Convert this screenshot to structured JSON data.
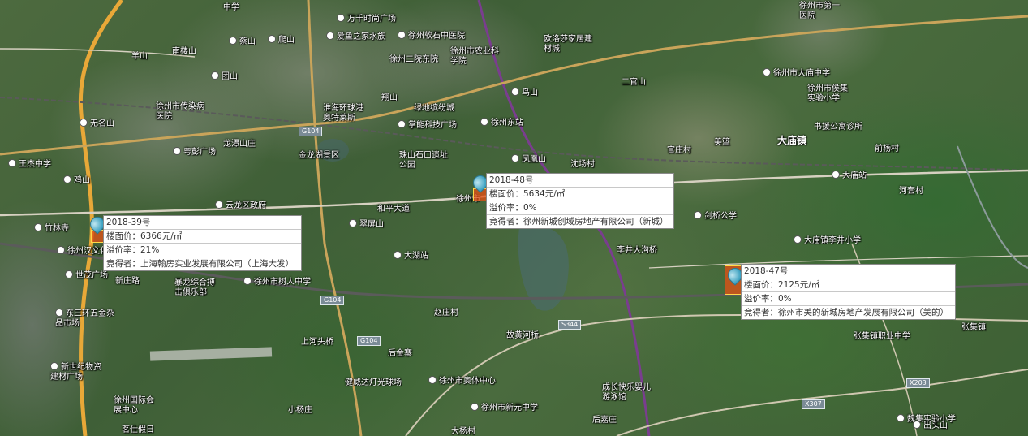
{
  "parcels": [
    {
      "id": "2018-39号",
      "floor_price": "楼面价：6366元/㎡",
      "premium": "溢价率：21%",
      "winner": "竟得者：上海翰房实业发展有限公司（上海大发）"
    },
    {
      "id": "2018-48号",
      "floor_price": "楼面价：5634元/㎡",
      "premium": "溢价率：0%",
      "winner": "竟得者：徐州新城创域房地产有限公司（新城）"
    },
    {
      "id": "2018-47号",
      "floor_price": "楼面价：2125元/㎡",
      "premium": "溢价率：0%",
      "winner": "竟得者：徐州市美的新城房地产发展有限公司（美的）"
    }
  ],
  "roads": [
    "G104",
    "G104",
    "G104",
    "S344",
    "X203",
    "X307"
  ],
  "labels": {
    "l1": "中学",
    "l2": "万千时尚广场",
    "l3": "徐州市第一医院",
    "l4": "羊山",
    "l5": "南楼山",
    "l6": "蔡山",
    "l7": "爬山",
    "l8": "爱鱼之家水族",
    "l9": "徐州软石中医院",
    "l10": "徐州市农业科学院",
    "l11": "欧洛莎家居建材城",
    "l12": "徐州二院东院",
    "l13": "团山",
    "l14": "徐州市传染病医院",
    "l15": "无名山",
    "l16": "淮海环球港奥特莱斯",
    "l17": "翔山",
    "l18": "绿地缤纷城",
    "l19": "掌能科技广场",
    "l20": "徐州东站",
    "l21": "鸟山",
    "l22": "二官山",
    "l23": "徐州市大庙中学",
    "l24": "徐州市侯集实验小学",
    "l25": "书援公寓诊所",
    "l26": "大庙镇",
    "l27": "粤彭广场",
    "l28": "龙潭山庄",
    "l29": "金龙湖景区",
    "l30": "珠山石口遗址公园",
    "l31": "凤凰山",
    "l32": "王杰中学",
    "l33": "鸡山",
    "l34": "云龙区政府",
    "l35": "徐州市",
    "l36": "和平大道",
    "l37": "剑桥公学",
    "l38": "大庙站",
    "l39": "竹林寺",
    "l40": "徐州汉文化",
    "l41": "翠屏山",
    "l42": "大湖站",
    "l43": "李井大沟桥",
    "l44": "大庙镇李井小学",
    "l45": "世茂广场",
    "l46": "新庄路",
    "l47": "暴龙综合搏击俱乐部",
    "l48": "徐州市树人中学",
    "l49": "东三环五金杂品市场",
    "l50": "赵庄村",
    "l51": "故黄河桥",
    "l52": "上河头桥",
    "l53": "后金寨",
    "l54": "新世纪物资建材广场",
    "l55": "健威达灯光球场",
    "l56": "徐州市奥体中心",
    "l57": "成长快乐婴儿游泳馆",
    "l58": "张集镇职业中学",
    "l59": "魏集实验小学",
    "l60": "徐州国际会展中心",
    "l61": "茗仕假日",
    "l62": "徐州市新元中学",
    "l63": "后嘉庄",
    "l64": "出头山",
    "l65": "官庄村",
    "l66": "沈场村",
    "l67": "美篮",
    "l68": "前杨村",
    "l69": "河套村",
    "l70": "张集镇",
    "l71": "大杨村",
    "l72": "小杨庄"
  },
  "colors": {
    "parcel_fill": "#e6501a",
    "parcel_border": "#ffd84a",
    "pin": "#3aa0c0",
    "railway": "#7a3d8f",
    "expressway": "#e8a838"
  }
}
